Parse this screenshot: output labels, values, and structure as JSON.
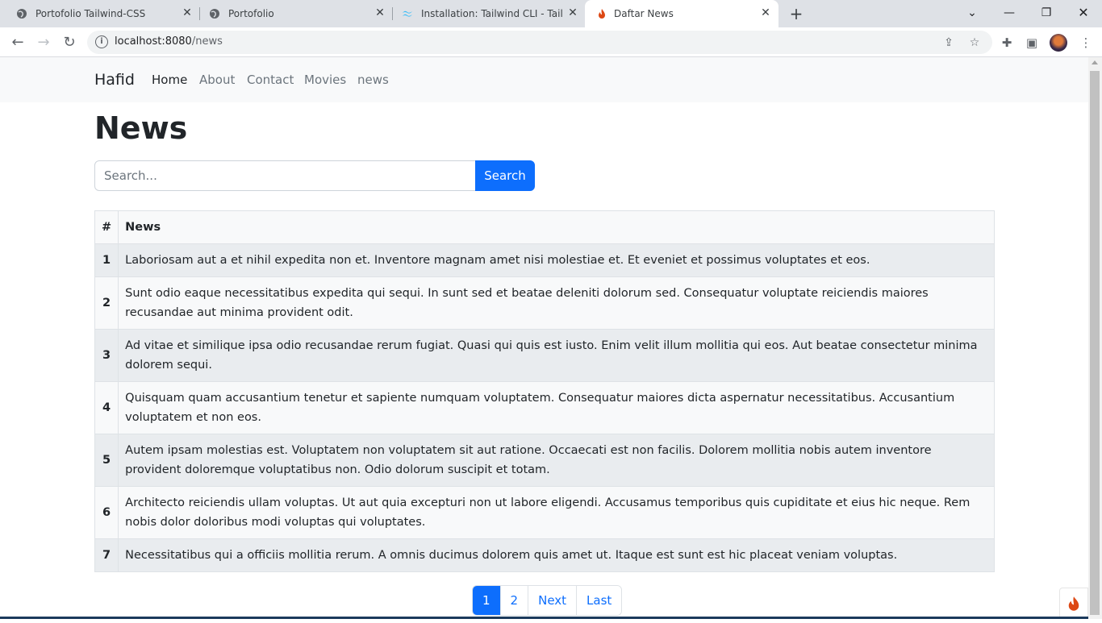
{
  "browser": {
    "tabs": [
      {
        "title": "Portofolio Tailwind-CSS",
        "icon": "globe-icon",
        "active": false
      },
      {
        "title": "Portofolio",
        "icon": "globe-icon",
        "active": false
      },
      {
        "title": "Installation: Tailwind CLI - Tailwind",
        "icon": "tailwind-icon",
        "active": false
      },
      {
        "title": "Daftar News",
        "icon": "flame-icon",
        "active": true
      }
    ],
    "new_tab": "+",
    "url_host": "localhost:8080",
    "url_path": "/news"
  },
  "navbar": {
    "brand": "Hafid",
    "links": [
      {
        "label": "Home",
        "active": true
      },
      {
        "label": "About",
        "active": false
      },
      {
        "label": "Contact",
        "active": false
      },
      {
        "label": "Movies",
        "active": false
      },
      {
        "label": "news",
        "active": false
      }
    ]
  },
  "page": {
    "title": "News",
    "search_placeholder": "Search...",
    "search_button": "Search"
  },
  "table": {
    "headers": [
      "#",
      "News"
    ],
    "rows": [
      {
        "num": "1",
        "text": "Laboriosam aut a et nihil expedita non et. Inventore magnam amet nisi molestiae et. Et eveniet et possimus voluptates et eos."
      },
      {
        "num": "2",
        "text": "Sunt odio eaque necessitatibus expedita qui sequi. In sunt sed et beatae deleniti dolorum sed. Consequatur voluptate reiciendis maiores recusandae aut minima provident odit."
      },
      {
        "num": "3",
        "text": "Ad vitae et similique ipsa odio recusandae rerum fugiat. Quasi qui quis est iusto. Enim velit illum mollitia qui eos. Aut beatae consectetur minima dolorem sequi."
      },
      {
        "num": "4",
        "text": "Quisquam quam accusantium tenetur et sapiente numquam voluptatem. Consequatur maiores dicta aspernatur necessitatibus. Accusantium voluptatem et non eos."
      },
      {
        "num": "5",
        "text": "Autem ipsam molestias est. Voluptatem non voluptatem sit aut ratione. Occaecati est non facilis. Dolorem mollitia nobis autem inventore provident doloremque voluptatibus non. Odio dolorum suscipit et totam."
      },
      {
        "num": "6",
        "text": "Architecto reiciendis ullam voluptas. Ut aut quia excepturi non ut labore eligendi. Accusamus temporibus quis cupiditate et eius hic neque. Rem nobis dolor doloribus modi voluptas qui voluptates."
      },
      {
        "num": "7",
        "text": "Necessitatibus qui a officiis mollitia rerum. A omnis ducimus dolorem quis amet ut. Itaque est sunt est hic placeat veniam voluptas."
      }
    ]
  },
  "pagination": {
    "items": [
      {
        "label": "1",
        "active": true
      },
      {
        "label": "2",
        "active": false
      },
      {
        "label": "Next",
        "active": false
      },
      {
        "label": "Last",
        "active": false
      }
    ]
  },
  "colors": {
    "primary": "#0d6efd",
    "navbar_bg": "#f8f9fa",
    "tabstrip_bg": "#dee1e6"
  }
}
